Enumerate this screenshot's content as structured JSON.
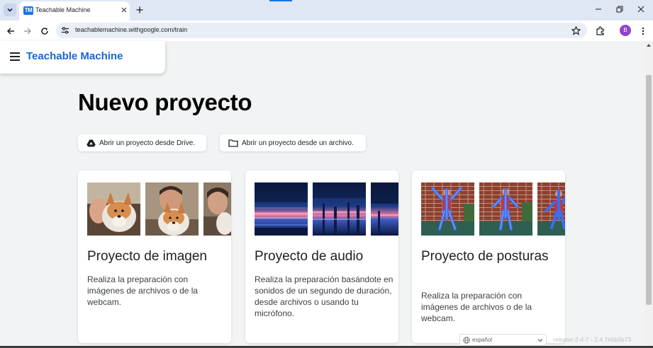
{
  "browser": {
    "tab_title": "Teachable Machine",
    "tab_favicon_text": "TM",
    "url": "teachablemachine.withgoogle.com/train",
    "avatar_letter": "B",
    "accent": "#1a73e8",
    "icons": [
      "tab-search-icon",
      "close-icon",
      "plus-icon",
      "minimize-icon",
      "restore-icon",
      "window-close-icon",
      "back-arrow-icon",
      "forward-arrow-icon",
      "reload-icon",
      "site-info-icon",
      "star-icon",
      "extensions-icon",
      "kebab-menu-icon"
    ]
  },
  "app": {
    "brand": "Teachable Machine",
    "brand_color": "#1967d2",
    "menu_icon": "hamburger-icon"
  },
  "main": {
    "title": "Nuevo proyecto",
    "open_drive_label": "Abrir un proyecto desde Drive.",
    "open_file_label": "Abrir un proyecto desde un archivo.",
    "cards": [
      {
        "title": "Proyecto de imagen",
        "description": "Realiza la preparación con imágenes de archivos o de la webcam.",
        "thumbnails": [
          "image-sample-1",
          "image-sample-2",
          "image-sample-3"
        ]
      },
      {
        "title": "Proyecto de audio",
        "description": "Realiza la preparación basándote en sonidos de un segundo de duración, desde archivos o usando tu micrófono.",
        "thumbnails": [
          "spectrogram-1",
          "spectrogram-2",
          "spectrogram-3"
        ]
      },
      {
        "title": "Proyecto de posturas",
        "description": "Realiza la preparación con imágenes de archivos o de la webcam.",
        "thumbnails": [
          "pose-sample-1",
          "pose-sample-2",
          "pose-sample-3"
        ]
      }
    ]
  },
  "footer": {
    "language": "español",
    "release": "release-2-4-7 - 2.4.7#5b5b73"
  }
}
